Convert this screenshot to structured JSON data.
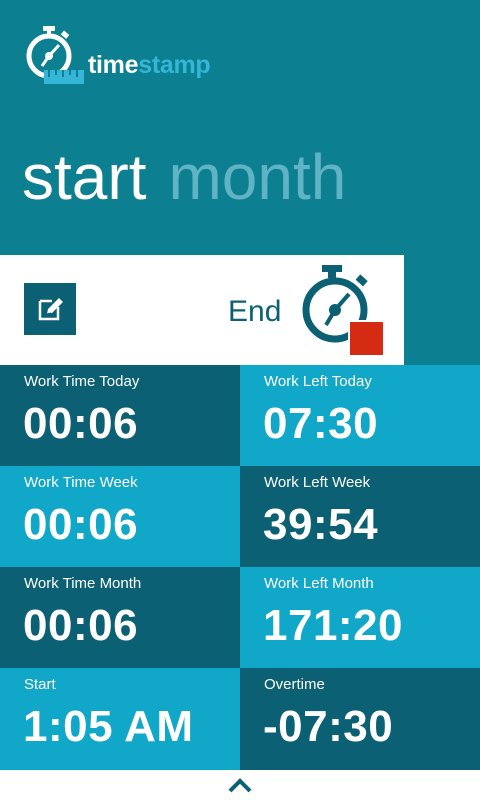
{
  "app": {
    "logo_word_white": "time",
    "logo_word_blue": "stamp"
  },
  "pivot": {
    "active": "start",
    "inactive": "month"
  },
  "action": {
    "end_label": "End"
  },
  "tiles": [
    {
      "label": "Work Time Today",
      "value": "00:06"
    },
    {
      "label": "Work Left Today",
      "value": "07:30"
    },
    {
      "label": "Work Time Week",
      "value": "00:06"
    },
    {
      "label": "Work Left Week",
      "value": "39:54"
    },
    {
      "label": "Work Time Month",
      "value": "00:06"
    },
    {
      "label": "Work Left Month",
      "value": "171:20"
    },
    {
      "label": "Start",
      "value": "1:05 AM"
    },
    {
      "label": "Overtime",
      "value": "-07:30"
    }
  ],
  "icons": {
    "logo": "stopwatch-ruler-icon",
    "edit": "edit-icon",
    "end": "stopwatch-stop-icon",
    "expand": "chevron-up-icon"
  },
  "colors": {
    "header_bg": "#0c7f91",
    "tile_dark": "#0b6173",
    "tile_light": "#10a7c8",
    "stop_red": "#d52b12",
    "logo_blue": "#35b6d6"
  }
}
